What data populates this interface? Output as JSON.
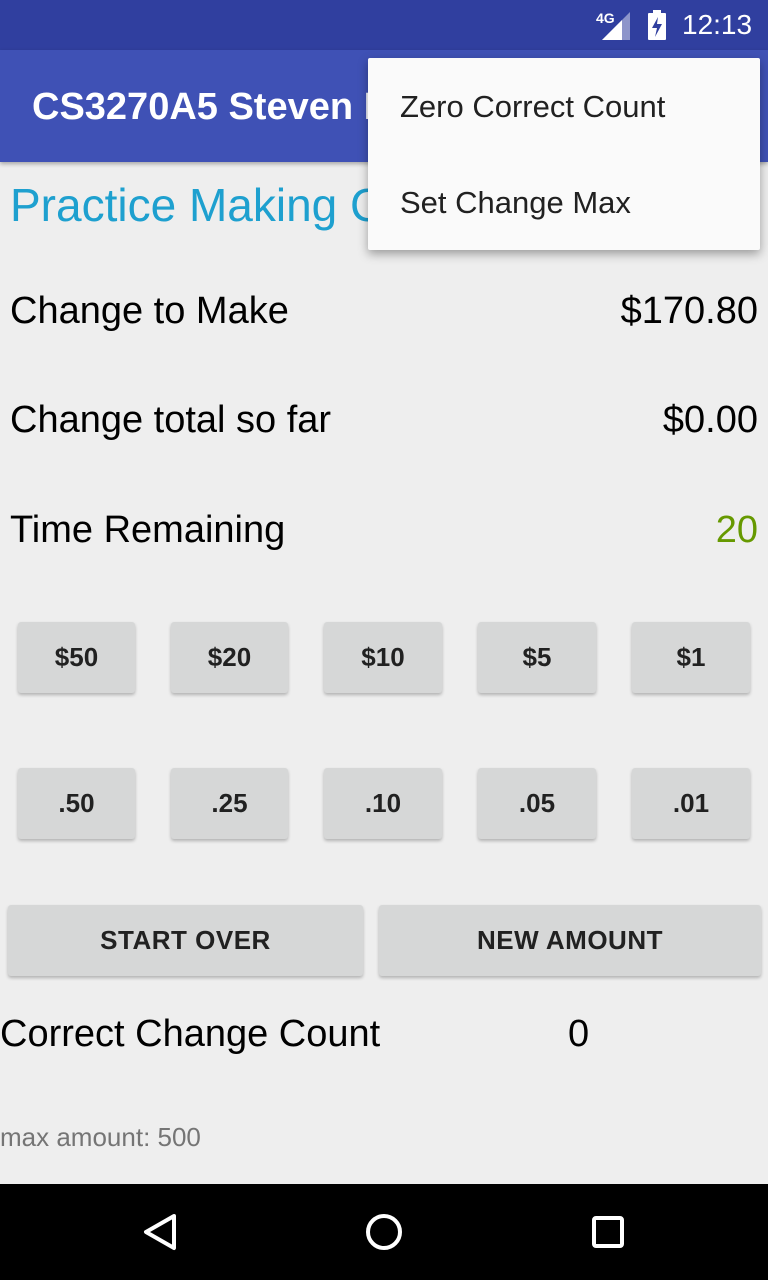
{
  "status_bar": {
    "network": "4G",
    "time": "12:13",
    "icons": [
      "signal-icon",
      "battery-charging-icon"
    ]
  },
  "app_bar": {
    "title": "CS3270A5 Steven Franklin"
  },
  "heading": "Practice Making Change",
  "rows": {
    "change_to_make": {
      "label": "Change to Make",
      "value": "$170.80"
    },
    "change_total": {
      "label": "Change total so far",
      "value": "$0.00"
    },
    "time_remaining": {
      "label": "Time Remaining",
      "value": "20",
      "value_color": "#669900"
    }
  },
  "bill_buttons": [
    "$50",
    "$20",
    "$10",
    "$5",
    "$1"
  ],
  "coin_buttons": [
    ".50",
    ".25",
    ".10",
    ".05",
    ".01"
  ],
  "actions": {
    "start_over": "START OVER",
    "new_amount": "NEW AMOUNT"
  },
  "correct_count": {
    "label": "Correct Change Count",
    "value": "0"
  },
  "max_amount_text": "max amount: 500",
  "overflow_menu": {
    "items": [
      "Zero Correct Count",
      "Set Change Max"
    ]
  },
  "nav_bar": {
    "icons": [
      "back-icon",
      "home-icon",
      "recents-icon"
    ]
  },
  "colors": {
    "status_bar": "#303f9f",
    "app_bar": "#3f51b5",
    "heading": "#1ea0cf",
    "button": "#d6d7d7",
    "background": "#eeeeee"
  }
}
